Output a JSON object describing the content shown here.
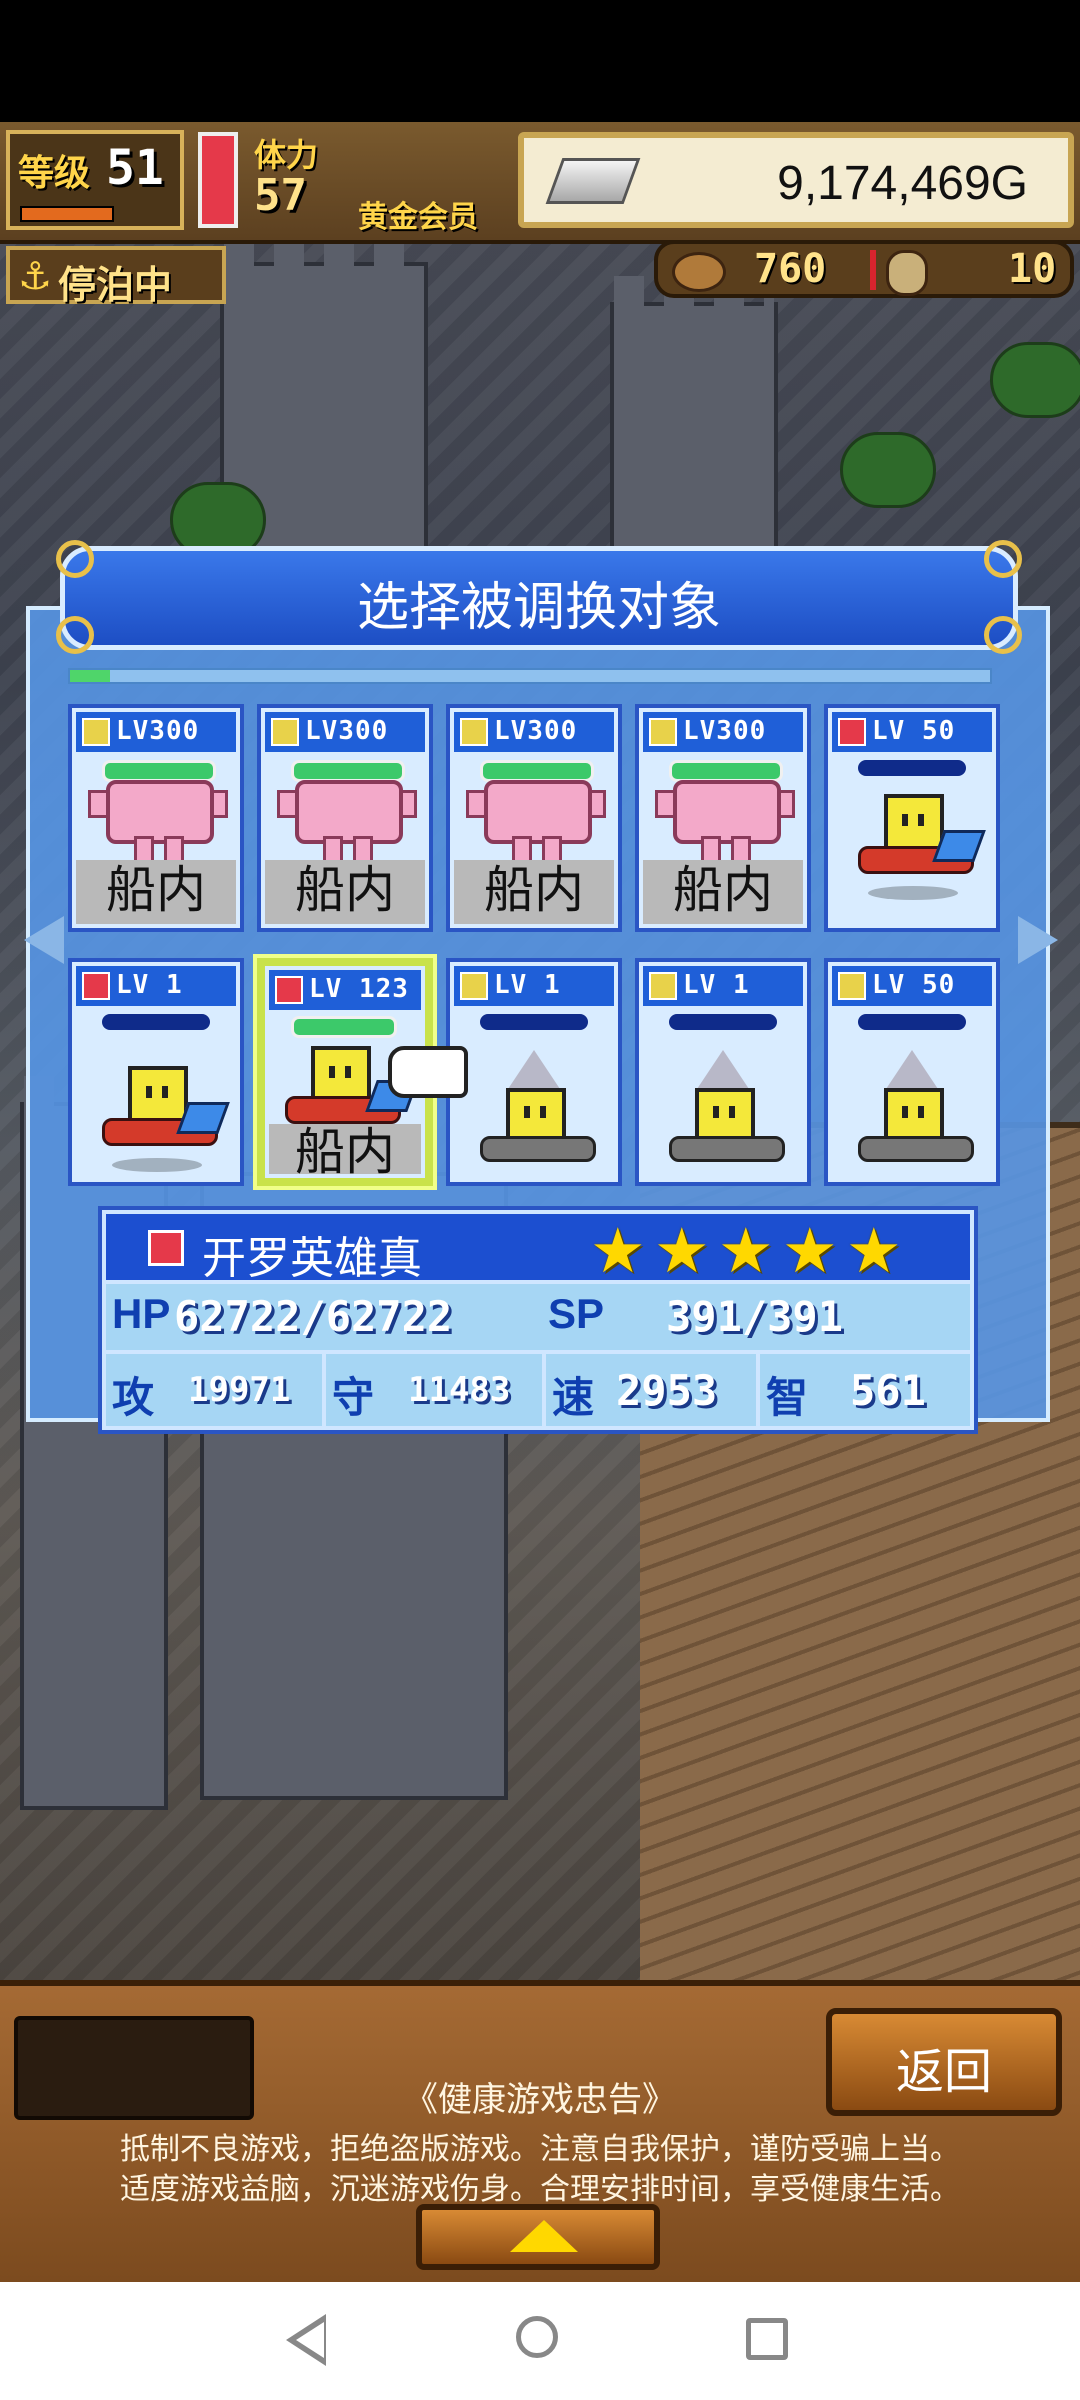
{
  "hud": {
    "level_label": "等级",
    "level_value": "51",
    "stamina_label": "体力",
    "stamina_value": "57",
    "member_label": "黄金会员",
    "gold_value": "9,174,469G",
    "dock_label": "停泊中",
    "resource1_value": "760",
    "resource2_value": "10"
  },
  "dialog": {
    "title": "选择被调换对象",
    "cards": [
      {
        "element": "yellow",
        "level": "LV300",
        "in_ship": true,
        "in_label": "船内",
        "sprite": "pink-creature"
      },
      {
        "element": "yellow",
        "level": "LV300",
        "in_ship": true,
        "in_label": "船内",
        "sprite": "pink-creature"
      },
      {
        "element": "yellow",
        "level": "LV300",
        "in_ship": true,
        "in_label": "船内",
        "sprite": "pink-creature"
      },
      {
        "element": "yellow",
        "level": "LV300",
        "in_ship": true,
        "in_label": "船内",
        "sprite": "pink-creature"
      },
      {
        "element": "red",
        "level": "LV 50",
        "in_ship": false,
        "sprite": "flying-yellow-hero"
      },
      {
        "element": "red",
        "level": "LV  1",
        "in_ship": false,
        "sprite": "flying-yellow-hero"
      },
      {
        "element": "red",
        "level": "LV 123",
        "in_ship": true,
        "in_label": "船内",
        "selected": true,
        "sprite": "flying-yellow-hero"
      },
      {
        "element": "yellow",
        "level": "LV  1",
        "in_ship": false,
        "sprite": "drill-yellow-hero"
      },
      {
        "element": "yellow",
        "level": "LV  1",
        "in_ship": false,
        "sprite": "drill-yellow-hero"
      },
      {
        "element": "yellow",
        "level": "LV 50",
        "in_ship": false,
        "sprite": "drill-yellow-hero"
      }
    ]
  },
  "info": {
    "name": "开罗英雄真",
    "stars": 5,
    "hp_label": "HP",
    "hp_value": "62722/62722",
    "sp_label": "SP",
    "sp_value": "391/391",
    "atk_label": "攻",
    "atk_value": "19971",
    "def_label": "守",
    "def_value": "11483",
    "spd_label": "速",
    "spd_value": "2953",
    "int_label": "智",
    "int_value": "561"
  },
  "bottom": {
    "back_label": "返回",
    "notice_title": "《健康游戏忠告》",
    "notice_line1": "抵制不良游戏，拒绝盗版游戏。注意自我保护，谨防受骗上当。",
    "notice_line2": "适度游戏益脑，沉迷游戏伤身。合理安排时间，享受健康生活。"
  },
  "colors": {
    "dialog_blue": "#1d4ec4",
    "card_border": "#2a55c4",
    "selected_border": "#c9e24a",
    "hud_brown": "#5c4020",
    "star_yellow": "#ffd800"
  }
}
